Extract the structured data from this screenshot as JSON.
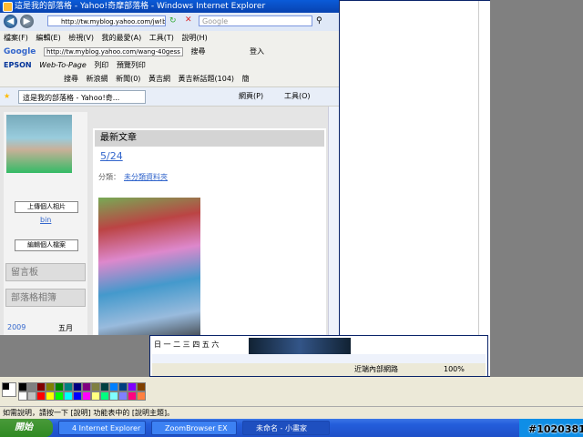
{
  "ie": {
    "title": "這是我的部落格 - Yahoo!奇摩部落格 - Windows Internet Explorer",
    "address": "http://tw.myblog.yahoo.com/jw!bYr",
    "google_placeholder": "Google",
    "menu": [
      "檔案(F)",
      "編輯(E)",
      "檢視(V)",
      "我的最愛(A)",
      "工具(T)",
      "說明(H)"
    ],
    "google_bar": {
      "logo": "Google",
      "url": "http://tw.myblog.yahoo.com/wang-40gess",
      "search": "搜尋",
      "login": "登入"
    },
    "epson_bar": {
      "logo": "EPSON",
      "web_to_page": "Web-To-Page",
      "print": "列印",
      "preview": "預覽列印"
    },
    "yahoo_bar": {
      "search": "搜尋",
      "news": "新浪網",
      "news2": "新聞(0)",
      "weather": "黃吉網",
      "weather2": "黃吉新話題(104)",
      "simp": "簡"
    },
    "tab": "這是我的部落格 - Yahoo!奇...",
    "tab_tools": {
      "page": "網頁(P)",
      "tools": "工具(O)"
    }
  },
  "blog": {
    "upload_photo": "上傳個人相片",
    "user": "bin",
    "edit_profile": "編輯個人檔案",
    "guestbook": "留言板",
    "photos": "部落格相簿",
    "year": "2009",
    "month": "五月",
    "section_title": "最新文章",
    "post_title": "5/24",
    "category_label": "分類：",
    "category_link": "未分類資料夾",
    "weekdays": [
      "日",
      "一",
      "二",
      "三",
      "四",
      "五",
      "六"
    ]
  },
  "status": {
    "zone": "近端內部網路",
    "zoom": "100%"
  },
  "paint_status": "如需說明，請按一下 [說明] 功能表中的 [說明主題]。",
  "taskbar": {
    "start": "開始",
    "tasks": [
      "4 Internet Explorer",
      "ZoomBrowser EX",
      "未命名 - 小畫家"
    ],
    "watermark": "#1020381"
  },
  "palette": [
    "#000000",
    "#808080",
    "#800000",
    "#808000",
    "#008000",
    "#008080",
    "#000080",
    "#800080",
    "#808040",
    "#004040",
    "#0080ff",
    "#004080",
    "#8000ff",
    "#804000",
    "#ffffff",
    "#c0c0c0",
    "#ff0000",
    "#ffff00",
    "#00ff00",
    "#00ffff",
    "#0000ff",
    "#ff00ff",
    "#ffff80",
    "#00ff80",
    "#80ffff",
    "#8080ff",
    "#ff0080",
    "#ff8040"
  ]
}
